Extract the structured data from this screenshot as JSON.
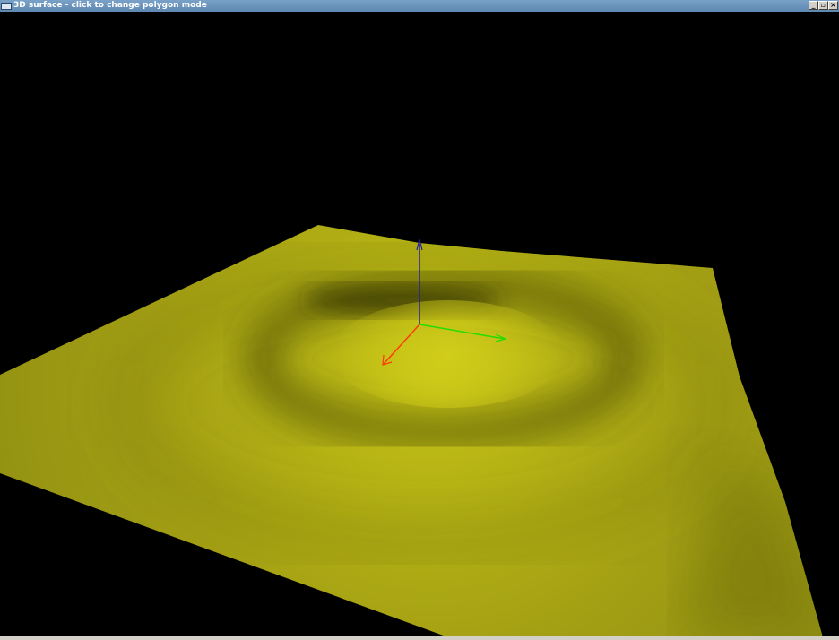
{
  "window": {
    "title": "3D surface - click to change polygon mode",
    "controls": {
      "minimize": "_",
      "restore": "▫",
      "close": "×"
    }
  },
  "scene": {
    "surface_color": "#b5b40c",
    "axis_colors": {
      "x": "#ff3a00",
      "y": "#22dd00",
      "z": "#2020a0"
    }
  }
}
